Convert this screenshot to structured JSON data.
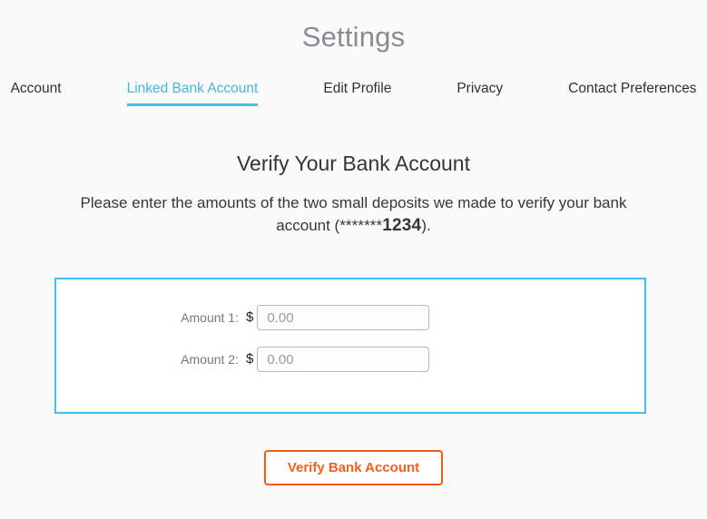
{
  "header": {
    "title": "Settings"
  },
  "tabs": [
    {
      "label": "Account",
      "active": false
    },
    {
      "label": "Linked Bank Account",
      "active": true
    },
    {
      "label": "Edit Profile",
      "active": false
    },
    {
      "label": "Privacy",
      "active": false
    },
    {
      "label": "Contact Preferences",
      "active": false
    }
  ],
  "main": {
    "heading": "Verify Your Bank Account",
    "description_prefix": "Please enter the amounts of the two small deposits we made to verify your bank account (",
    "account_mask": "*******",
    "account_last4": "1234",
    "description_suffix": ").",
    "full_description": "Please enter the amounts of the two small deposits we made to verify your bank account (*******1234)."
  },
  "form": {
    "fields": [
      {
        "label": "Amount 1:",
        "currency": "$",
        "value": "",
        "placeholder": "0.00"
      },
      {
        "label": "Amount 2:",
        "currency": "$",
        "value": "",
        "placeholder": "0.00"
      }
    ]
  },
  "actions": {
    "submit_label": "Verify Bank Account"
  },
  "colors": {
    "page_background": "#fafafa",
    "title_gray": "#8b8b96",
    "accent_blue": "#3fc0ef",
    "accent_orange": "#f65b10",
    "text_dark": "#34343c",
    "label_gray": "#777780",
    "input_border": "#b7b7bd"
  }
}
